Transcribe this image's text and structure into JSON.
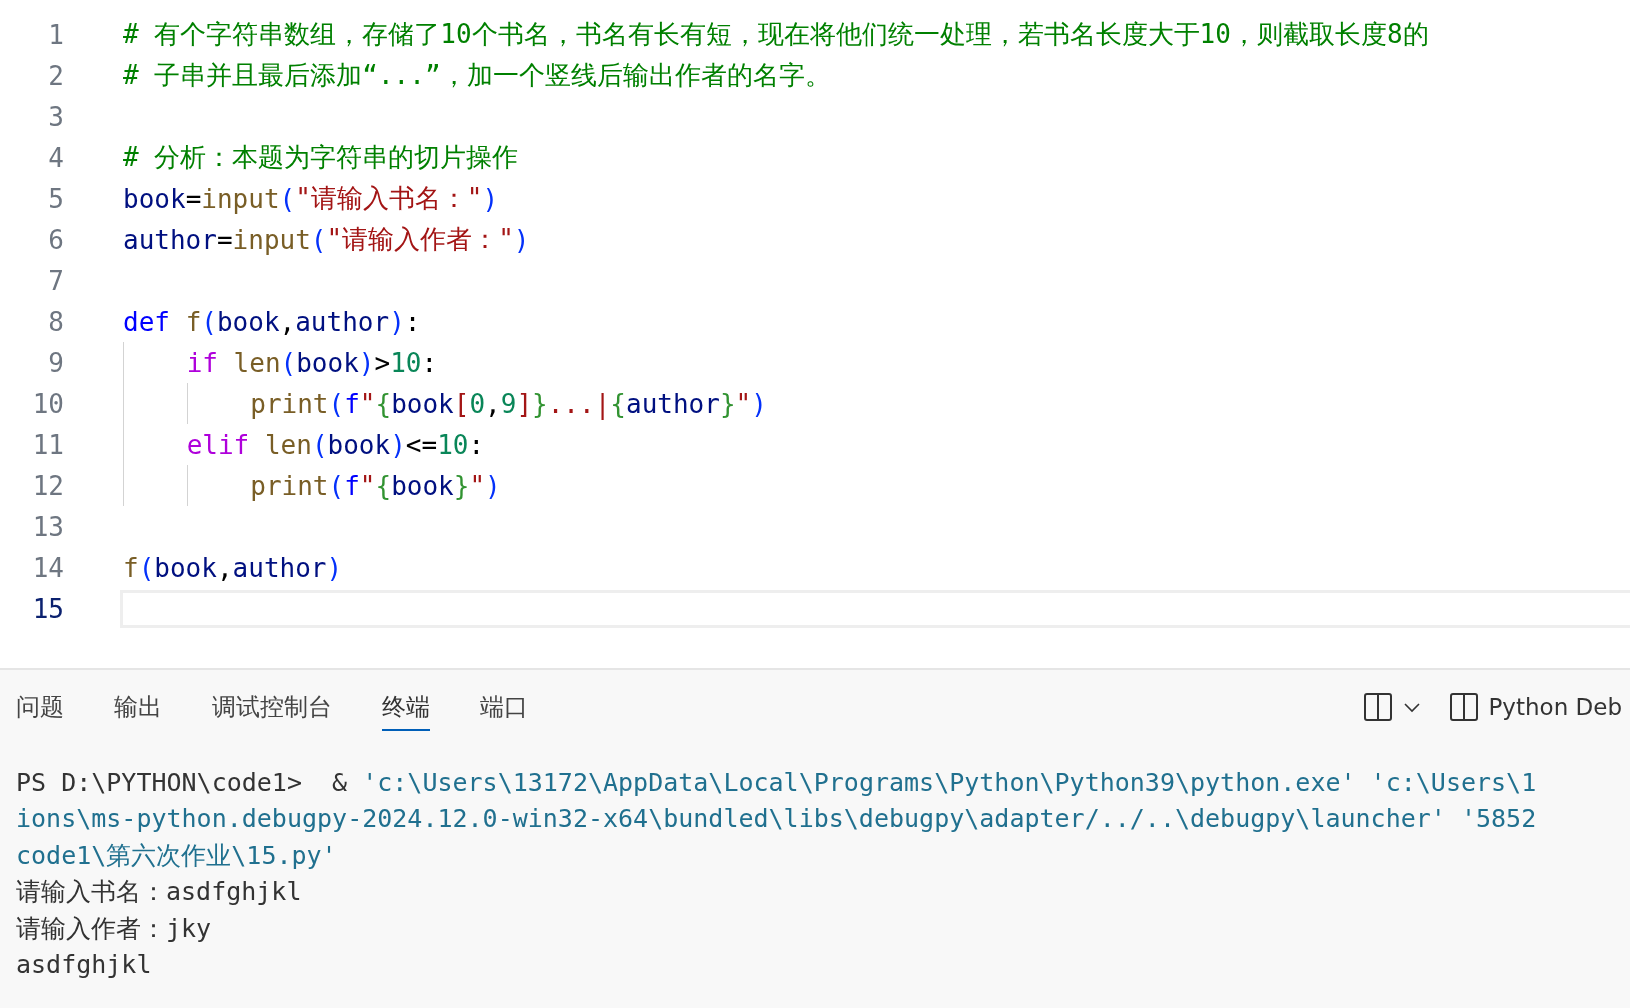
{
  "editor": {
    "lines": [
      {
        "number": "1",
        "current": false,
        "tokens": [
          {
            "kind": "comment",
            "text": "# 有个字符串数组，存储了10个书名，书名有长有短，现在将他们统一处理，若书名长度大于10，则截取长度8的"
          }
        ]
      },
      {
        "number": "2",
        "current": false,
        "tokens": [
          {
            "kind": "comment",
            "text": "# 子串并且最后添加“...”，加一个竖线后输出作者的名字。"
          }
        ]
      },
      {
        "number": "3",
        "current": false
      },
      {
        "number": "4",
        "current": false,
        "tokens": [
          {
            "kind": "comment",
            "text": "# 分析：本题为字符串的切片操作"
          }
        ]
      },
      {
        "number": "5",
        "current": false,
        "tokens": [
          {
            "kind": "var",
            "text": "book"
          },
          {
            "kind": "op",
            "text": "="
          },
          {
            "kind": "fn",
            "text": "input"
          },
          {
            "kind": "paren",
            "text": "("
          },
          {
            "kind": "str",
            "text": "\"请输入书名：\""
          },
          {
            "kind": "paren",
            "text": ")"
          }
        ]
      },
      {
        "number": "6",
        "current": false,
        "tokens": [
          {
            "kind": "var",
            "text": "author"
          },
          {
            "kind": "op",
            "text": "="
          },
          {
            "kind": "fn",
            "text": "input"
          },
          {
            "kind": "paren",
            "text": "("
          },
          {
            "kind": "str",
            "text": "\"请输入作者：\""
          },
          {
            "kind": "paren",
            "text": ")"
          }
        ]
      },
      {
        "number": "7",
        "current": false
      },
      {
        "number": "8",
        "current": false,
        "tokens": [
          {
            "kind": "kw",
            "text": "def "
          },
          {
            "kind": "fn",
            "text": "f"
          },
          {
            "kind": "paren",
            "text": "("
          },
          {
            "kind": "var",
            "text": "book"
          },
          {
            "kind": "op",
            "text": ","
          },
          {
            "kind": "var",
            "text": "author"
          },
          {
            "kind": "paren",
            "text": ")"
          },
          {
            "kind": "op",
            "text": ":"
          }
        ]
      },
      {
        "number": "9",
        "current": false,
        "tokens": [
          {
            "kind": "ctrl",
            "text": "    if "
          },
          {
            "kind": "fn",
            "text": "len"
          },
          {
            "kind": "paren",
            "text": "("
          },
          {
            "kind": "var",
            "text": "book"
          },
          {
            "kind": "paren",
            "text": ")"
          },
          {
            "kind": "op",
            "text": ">"
          },
          {
            "kind": "num",
            "text": "10"
          },
          {
            "kind": "op",
            "text": ":"
          }
        ]
      },
      {
        "number": "10",
        "current": false,
        "tokens": [
          {
            "kind": "fn",
            "text": "        print"
          },
          {
            "kind": "paren",
            "text": "("
          },
          {
            "kind": "kw",
            "text": "f"
          },
          {
            "kind": "str",
            "text": "\""
          },
          {
            "kind": "brace",
            "text": "{"
          },
          {
            "kind": "var",
            "text": "book"
          },
          {
            "kind": "str",
            "text": "["
          },
          {
            "kind": "num",
            "text": "0"
          },
          {
            "kind": "op",
            "text": ","
          },
          {
            "kind": "num",
            "text": "9"
          },
          {
            "kind": "str",
            "text": "]"
          },
          {
            "kind": "brace",
            "text": "}"
          },
          {
            "kind": "str",
            "text": "...|"
          },
          {
            "kind": "brace",
            "text": "{"
          },
          {
            "kind": "var",
            "text": "author"
          },
          {
            "kind": "brace",
            "text": "}"
          },
          {
            "kind": "str",
            "text": "\""
          },
          {
            "kind": "paren",
            "text": ")"
          }
        ]
      },
      {
        "number": "11",
        "current": false,
        "tokens": [
          {
            "kind": "ctrl",
            "text": "    elif "
          },
          {
            "kind": "fn",
            "text": "len"
          },
          {
            "kind": "paren",
            "text": "("
          },
          {
            "kind": "var",
            "text": "book"
          },
          {
            "kind": "paren",
            "text": ")"
          },
          {
            "kind": "op",
            "text": "<="
          },
          {
            "kind": "num",
            "text": "10"
          },
          {
            "kind": "op",
            "text": ":"
          }
        ]
      },
      {
        "number": "12",
        "current": false,
        "tokens": [
          {
            "kind": "fn",
            "text": "        print"
          },
          {
            "kind": "paren",
            "text": "("
          },
          {
            "kind": "kw",
            "text": "f"
          },
          {
            "kind": "str",
            "text": "\""
          },
          {
            "kind": "brace",
            "text": "{"
          },
          {
            "kind": "var",
            "text": "book"
          },
          {
            "kind": "brace",
            "text": "}"
          },
          {
            "kind": "str",
            "text": "\""
          },
          {
            "kind": "paren",
            "text": ")"
          }
        ]
      },
      {
        "number": "13",
        "current": false
      },
      {
        "number": "14",
        "current": false,
        "tokens": [
          {
            "kind": "fn",
            "text": "f"
          },
          {
            "kind": "paren",
            "text": "("
          },
          {
            "kind": "var",
            "text": "book"
          },
          {
            "kind": "op",
            "text": ","
          },
          {
            "kind": "var",
            "text": "author"
          },
          {
            "kind": "paren",
            "text": ")"
          }
        ]
      },
      {
        "number": "15",
        "current": true
      }
    ]
  },
  "panel": {
    "tabs": [
      {
        "label": "问题",
        "selected": false
      },
      {
        "label": "输出",
        "selected": false
      },
      {
        "label": "调试控制台",
        "selected": false
      },
      {
        "label": "终端",
        "selected": true
      },
      {
        "label": "端口",
        "selected": false
      }
    ],
    "terminal_name": "Python Deb",
    "terminal": [
      [
        {
          "kind": "prompt",
          "text": "PS D:\\PYTHON\\code1>  & "
        },
        {
          "kind": "path",
          "text": "'c:\\Users\\13172\\AppData\\Local\\Programs\\Python\\Python39\\python.exe' 'c:\\Users\\1"
        }
      ],
      [
        {
          "kind": "path",
          "text": "ions\\ms-python.debugpy-2024.12.0-win32-x64\\bundled\\libs\\debugpy\\adapter/../..\\debugpy\\launcher' '5852"
        }
      ],
      [
        {
          "kind": "path",
          "text": "code1\\第六次作业\\15.py'"
        }
      ],
      [
        {
          "kind": "prompt",
          "text": "请输入书名：asdfghjkl"
        }
      ],
      [
        {
          "kind": "prompt",
          "text": "请输入作者：jky"
        }
      ],
      [
        {
          "kind": "prompt",
          "text": "asdfghjkl"
        }
      ]
    ]
  }
}
